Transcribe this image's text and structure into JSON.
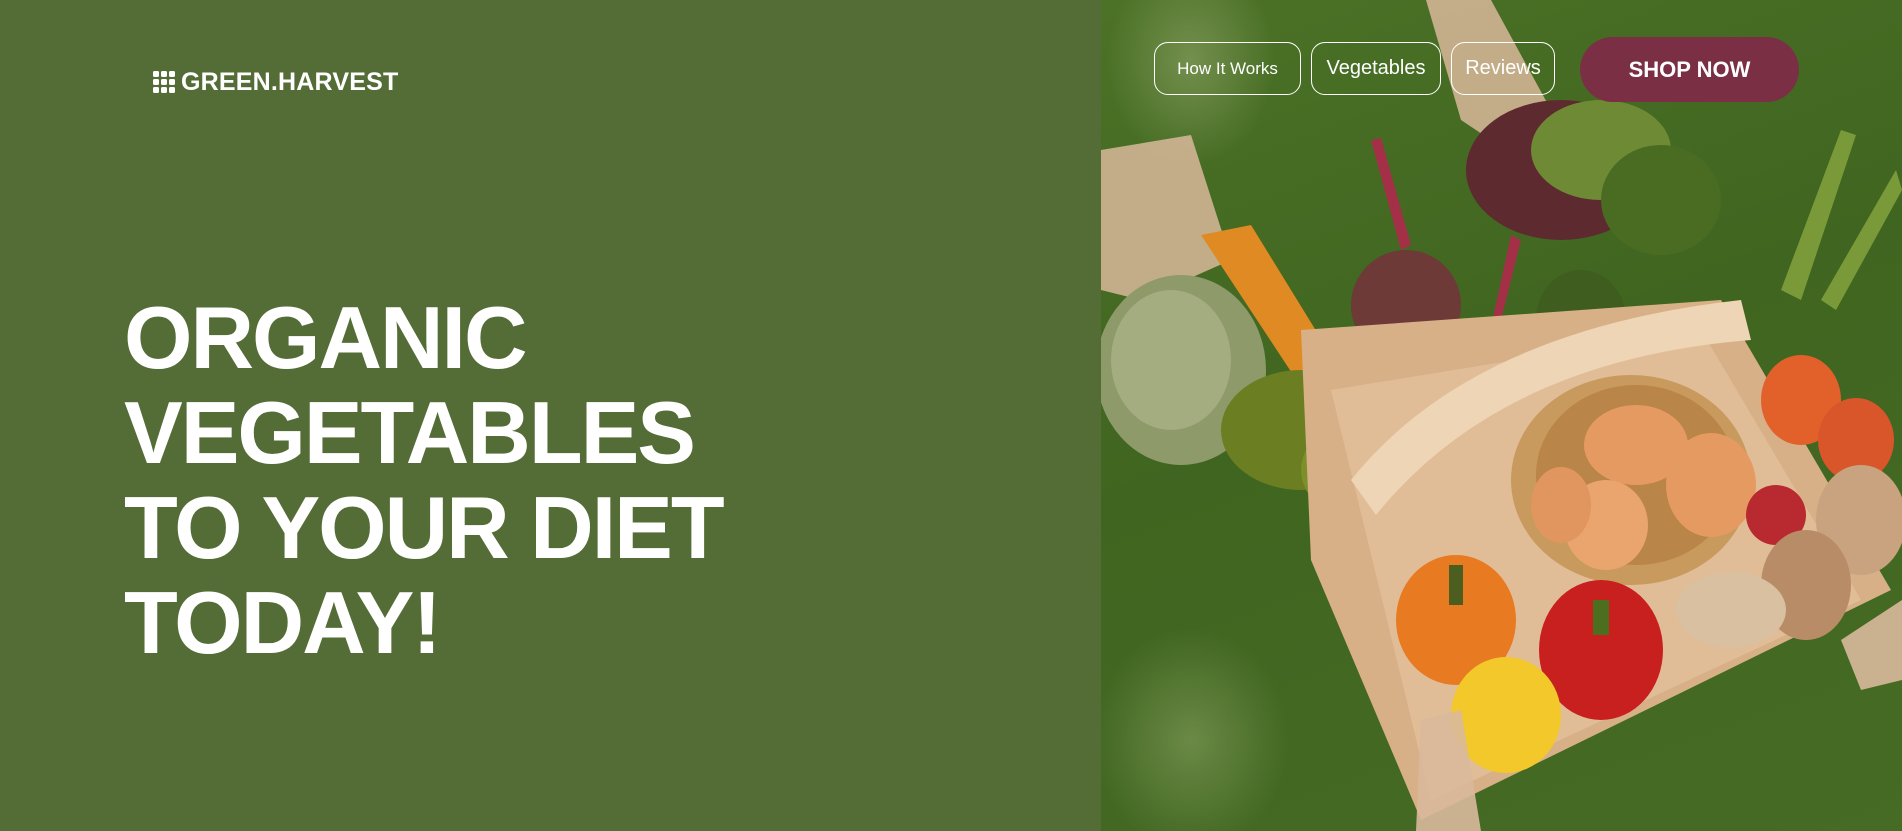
{
  "brand": {
    "name": "GREEN.HARVEST",
    "icon": "grid-icon"
  },
  "nav": {
    "items": [
      {
        "label": "How It Works"
      },
      {
        "label": "Vegetables"
      },
      {
        "label": "Reviews"
      }
    ],
    "cta_label": "SHOP NOW"
  },
  "hero": {
    "headline_lines": [
      "ORGANIC",
      "VEGETABLES",
      "TO YOUR DIET",
      "TODAY!"
    ]
  },
  "colors": {
    "primary_green": "#546c36",
    "cta_bg": "#7a2f45",
    "text": "#ffffff"
  }
}
